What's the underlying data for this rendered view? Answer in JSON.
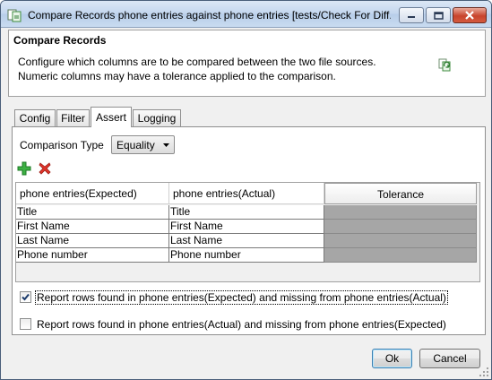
{
  "window": {
    "title": "Compare Records phone entries against phone entries [tests/Check For Diff...",
    "icon": "compare-records-icon"
  },
  "header": {
    "title": "Compare Records",
    "description_line1": "Configure which columns are to be compared between the two file sources.",
    "description_line2": "Numeric columns may have a tolerance applied to the comparison.",
    "icon": "refresh-compare-icon"
  },
  "tabs": [
    {
      "label": "Config",
      "active": false
    },
    {
      "label": "Filter",
      "active": false
    },
    {
      "label": "Assert",
      "active": true
    },
    {
      "label": "Logging",
      "active": false
    }
  ],
  "assert": {
    "comparison_type_label": "Comparison Type",
    "comparison_type_value": "Equality",
    "add_icon": "add-green-plus-icon",
    "delete_icon": "delete-red-x-icon"
  },
  "grid": {
    "headers": [
      "phone entries(Expected)",
      "phone entries(Actual)",
      "Tolerance"
    ],
    "rows": [
      [
        "Title",
        "Title",
        ""
      ],
      [
        "First Name",
        "First Name",
        ""
      ],
      [
        "Last Name",
        "Last  Name",
        ""
      ],
      [
        "Phone number",
        "Phone number",
        ""
      ]
    ]
  },
  "options": [
    {
      "label": "Report rows found in phone entries(Expected) and missing from phone entries(Actual)",
      "checked": true
    },
    {
      "label": "Report rows found in phone entries(Actual) and missing from phone entries(Expected)",
      "checked": false
    }
  ],
  "buttons": {
    "ok": "Ok",
    "cancel": "Cancel"
  },
  "colors": {
    "tolerance_cell": "#a6a6a6",
    "ok_focus_border": "#3c7fb1",
    "close_button": "#c8442d"
  }
}
